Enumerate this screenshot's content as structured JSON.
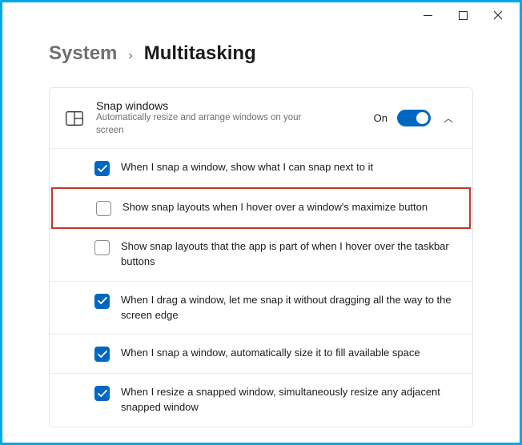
{
  "breadcrumb": {
    "parent": "System",
    "separator": "›",
    "current": "Multitasking"
  },
  "snap_section": {
    "title": "Snap windows",
    "subtitle": "Automatically resize and arrange windows on your screen",
    "toggle_state_label": "On",
    "options": [
      {
        "checked": true,
        "label": "When I snap a window, show what I can snap next to it"
      },
      {
        "checked": false,
        "label": "Show snap layouts when I hover over a window's maximize button",
        "highlighted": true
      },
      {
        "checked": false,
        "label": "Show snap layouts that the app is part of when I hover over the taskbar buttons"
      },
      {
        "checked": true,
        "label": "When I drag a window, let me snap it without dragging all the way to the screen edge"
      },
      {
        "checked": true,
        "label": "When I snap a window, automatically size it to fill available space"
      },
      {
        "checked": true,
        "label": "When I resize a snapped window, simultaneously resize any adjacent snapped window"
      }
    ]
  }
}
